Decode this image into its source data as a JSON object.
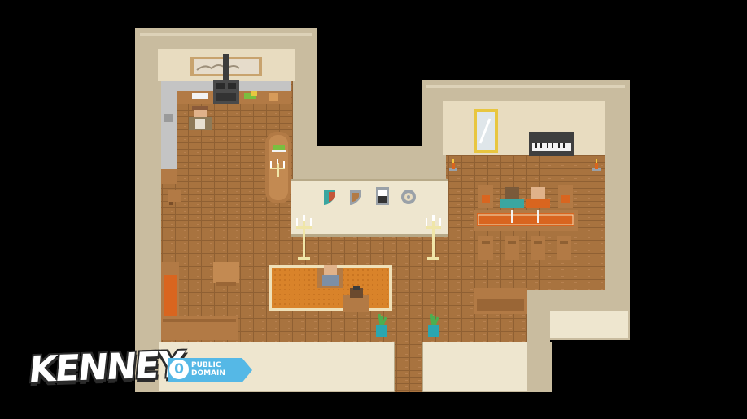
{
  "logo": {
    "brand_text": "KENNEY",
    "license_icon": "0",
    "license_line1": "PUBLIC",
    "license_line2": "DOMAIN"
  },
  "colors": {
    "background": "#000000",
    "outer_wall": "#c9bc9f",
    "wall_top": "#e8dcc0",
    "inner_wall": "#eee6cf",
    "floor": "#a8733f",
    "floor_dark": "#8f6033",
    "rug": "#d9832a",
    "rug_border": "#efe0b8",
    "table_cloth": "#d9651f",
    "wood": "#b27a45",
    "badge_blue": "#55b8e6"
  }
}
